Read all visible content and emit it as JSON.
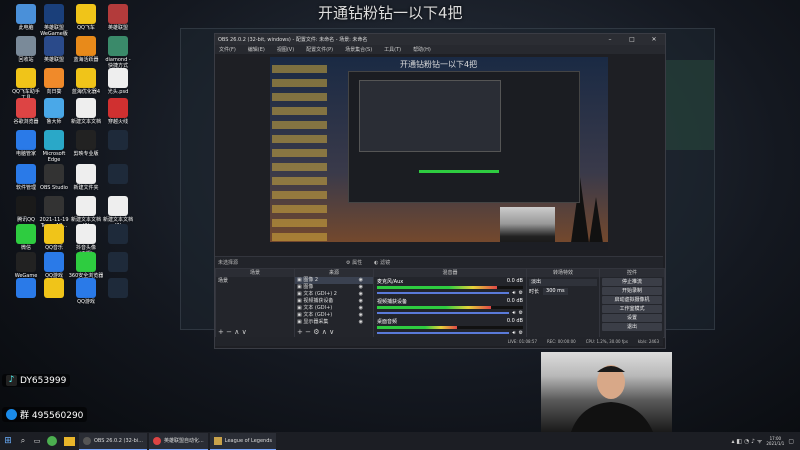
{
  "overlay_title": "开通钻粉钻一以下4把",
  "desktop_icons": [
    {
      "label": "此电脑",
      "color": "#4a90d9"
    },
    {
      "label": "英雄联盟\nWeGame版",
      "color": "#1a3f7a"
    },
    {
      "label": "QQ飞车",
      "color": "#f0c419"
    },
    {
      "label": "英雄联盟",
      "color": "#b33b3b"
    },
    {
      "label": "回收站",
      "color": "#7a8a99"
    },
    {
      "label": "英雄联盟",
      "color": "#2a4a8a"
    },
    {
      "label": "蓝海活跃器",
      "color": "#e88a1a"
    },
    {
      "label": "diamond -\n快捷方式",
      "color": "#3a8a6a"
    },
    {
      "label": "QQ飞车助手\n工具",
      "color": "#f0c419"
    },
    {
      "label": "向日葵",
      "color": "#f08a2a"
    },
    {
      "label": "蓝海优化器4",
      "color": "#f0c419"
    },
    {
      "label": "光头.psd",
      "color": "#eeeeee"
    },
    {
      "label": "谷歌浏览器",
      "color": "#dd4444"
    },
    {
      "label": "鲁大师",
      "color": "#4aa8e8"
    },
    {
      "label": "新建文本文档",
      "color": "#eeeeee"
    },
    {
      "label": "穿越火线",
      "color": "#d03030"
    },
    {
      "label": "电脑管家",
      "color": "#2a7ae8"
    },
    {
      "label": "Microsoft\nEdge",
      "color": "#2aa8c8"
    },
    {
      "label": "剪映专业版",
      "color": "#222222"
    },
    {
      "label": "",
      "color": "#1e2a3a"
    },
    {
      "label": "软件管理",
      "color": "#2a7ae8"
    },
    {
      "label": "OBS Studio",
      "color": "#333333"
    },
    {
      "label": "新建文件夹",
      "color": "#eeeeee"
    },
    {
      "label": "",
      "color": "#1e2a3a"
    },
    {
      "label": "腾讯QQ",
      "color": "#1a1a1a"
    },
    {
      "label": "2021-11-19\nTeam AR...",
      "color": "#333333"
    },
    {
      "label": "新建文本文档\n(3)",
      "color": "#eeeeee"
    },
    {
      "label": "新建文本文档\n(2)",
      "color": "#eeeeee"
    },
    {
      "label": "微信",
      "color": "#2ecc40"
    },
    {
      "label": "QQ音乐",
      "color": "#f0c419"
    },
    {
      "label": "抖音头像\n(无损)",
      "color": "#eeeeee"
    },
    {
      "label": "",
      "color": "#1e2a3a"
    },
    {
      "label": "WeGame",
      "color": "#222222"
    },
    {
      "label": "QQ游戏",
      "color": "#2a7ae8"
    },
    {
      "label": "360安全浏览器",
      "color": "#2ecc40"
    },
    {
      "label": "",
      "color": "#1e2a3a"
    },
    {
      "label": "",
      "color": "#2a7ae8"
    },
    {
      "label": "",
      "color": "#f0c419"
    },
    {
      "label": "QQ游戏",
      "color": "#2a7ae8"
    },
    {
      "label": "",
      "color": "#1e2a3a"
    }
  ],
  "contact_overlays": [
    {
      "label": "DY653999",
      "icon": "douyin-icon"
    },
    {
      "label": "群 495560290",
      "icon": "qq-icon"
    }
  ],
  "obs": {
    "title": "OBS 26.0.2 (32-bit, windows) - 配置文件: 未命名 - 场景: 未命名",
    "menu": [
      "文件(F)",
      "编辑(E)",
      "视图(V)",
      "配置文件(P)",
      "场景集合(S)",
      "工具(T)",
      "帮助(H)"
    ],
    "preview_title": "开通钻粉钻一以下4把",
    "no_source": "未选择源",
    "props_btn": "属性",
    "filters_btn": "滤镜",
    "scenes_header": "场景",
    "scene_item": "场景",
    "sources_header": "来源",
    "sources": [
      "图像 2",
      "图像",
      "文本 (GDI+) 2",
      "视频捕获设备",
      "文本 (GDI+)",
      "文本 (GDI+)",
      "显示器采集"
    ],
    "mixer_header": "混音器",
    "mixer": [
      {
        "name": "麦克风/Aux",
        "db": "0.0 dB",
        "level": 0.82
      },
      {
        "name": "视频捕获设备",
        "db": "0.0 dB",
        "level": 0.78
      },
      {
        "name": "桌面音频",
        "db": "0.0 dB",
        "level": 0.55
      }
    ],
    "transition_header": "转场特效",
    "transition_value": "淡出",
    "duration_label": "时长",
    "duration_value": "300 ms",
    "controls_header": "控件",
    "controls": [
      "停止推流",
      "开始录制",
      "启动虚拟摄像机",
      "工作室模式",
      "设置",
      "退出"
    ],
    "status": {
      "live": "LIVE: 01:08:57",
      "rec": "REC: 00:00:00",
      "cpu": "CPU: 1.2%, 30.00 fps",
      "kbps": "kb/s: 2463"
    }
  },
  "taskbar": {
    "items": [
      "OBS 26.0.2 (32-bi...",
      "英雄联盟自动化...",
      "League of Legends"
    ],
    "time": "17:00",
    "date": "2021/1/1"
  }
}
